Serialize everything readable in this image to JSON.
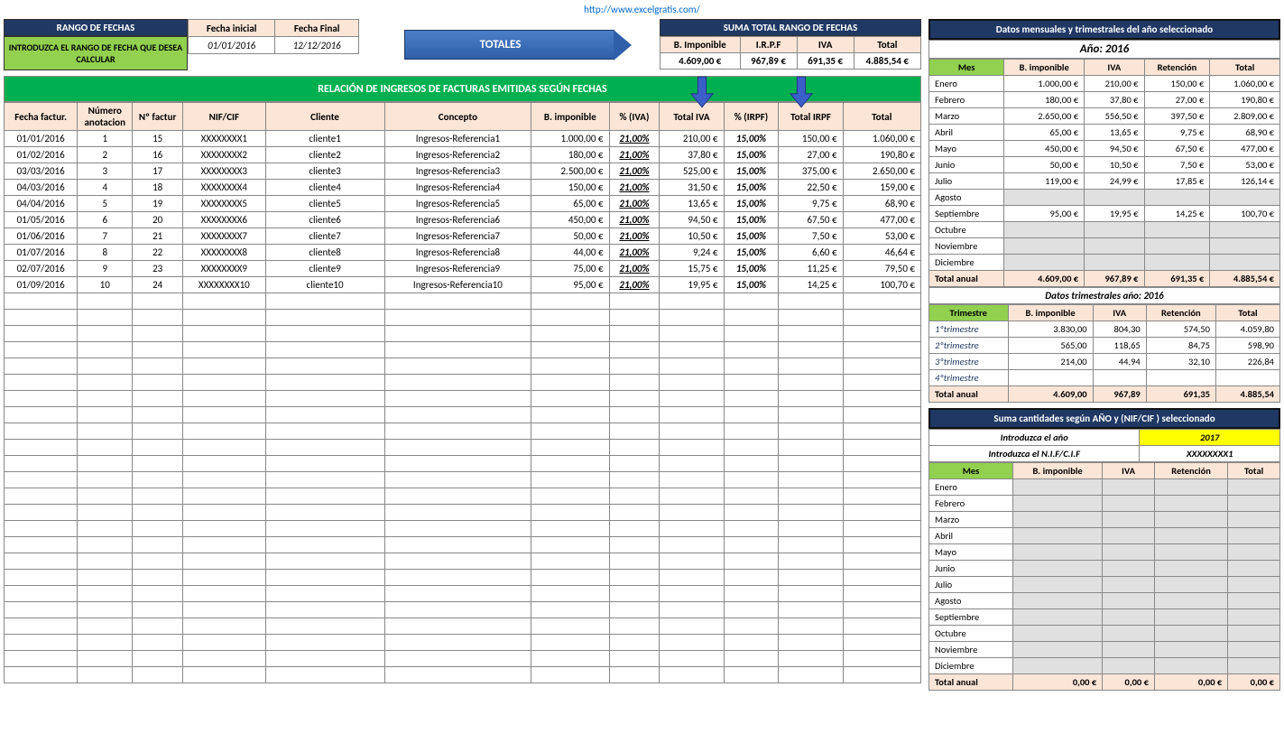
{
  "toplink": "http://www.excelgratis.com/",
  "headers": {
    "rango_fechas": "RANGO DE FECHAS",
    "intro_rango": "INTRODUZCA EL RANGO DE FECHA QUE DESEA CALCULAR",
    "fecha_inicial": "Fecha inicial",
    "fecha_final": "Fecha Final",
    "fecha_inicial_val": "01/01/2016",
    "fecha_final_val": "12/12/2016",
    "totales": "TOTALES",
    "suma_total": "SUMA TOTAL RANGO DE FECHAS",
    "bimponible": "B. Imponible",
    "irpf": "I.R.P.F",
    "iva": "IVA",
    "total": "Total",
    "bimponible_val": "4.609,00 €",
    "irpf_val": "967,89 €",
    "iva_val": "691,35 €",
    "total_val": "4.885,54 €",
    "green_banner": "RELACIÓN DE INGRESOS  DE FACTURAS EMITIDAS SEGÚN FECHAS"
  },
  "main_cols": [
    "Fecha factur.",
    "Número anotacion",
    "Nº factur",
    "NIF/CIF",
    "Cliente",
    "Concepto",
    "B. imponible",
    "% (IVA)",
    "Total IVA",
    "% (IRPF)",
    "Total IRPF",
    "Total"
  ],
  "main_rows": [
    [
      "01/01/2016",
      "1",
      "15",
      "XXXXXXXX1",
      "cliente1",
      "Ingresos-Referencia1",
      "1.000,00 €",
      "21,00%",
      "210,00 €",
      "15,00%",
      "150,00 €",
      "1.060,00 €"
    ],
    [
      "01/02/2016",
      "2",
      "16",
      "XXXXXXXX2",
      "cliente2",
      "Ingresos-Referencia2",
      "180,00 €",
      "21,00%",
      "37,80 €",
      "15,00%",
      "27,00 €",
      "190,80 €"
    ],
    [
      "03/03/2016",
      "3",
      "17",
      "XXXXXXXX3",
      "cliente3",
      "Ingresos-Referencia3",
      "2.500,00 €",
      "21,00%",
      "525,00 €",
      "15,00%",
      "375,00 €",
      "2.650,00 €"
    ],
    [
      "04/03/2016",
      "4",
      "18",
      "XXXXXXXX4",
      "cliente4",
      "Ingresos-Referencia4",
      "150,00 €",
      "21,00%",
      "31,50 €",
      "15,00%",
      "22,50 €",
      "159,00 €"
    ],
    [
      "04/04/2016",
      "5",
      "19",
      "XXXXXXXX5",
      "cliente5",
      "Ingresos-Referencia5",
      "65,00 €",
      "21,00%",
      "13,65 €",
      "15,00%",
      "9,75 €",
      "68,90 €"
    ],
    [
      "01/05/2016",
      "6",
      "20",
      "XXXXXXXX6",
      "cliente6",
      "Ingresos-Referencia6",
      "450,00 €",
      "21,00%",
      "94,50 €",
      "15,00%",
      "67,50 €",
      "477,00 €"
    ],
    [
      "01/06/2016",
      "7",
      "21",
      "XXXXXXXX7",
      "cliente7",
      "Ingresos-Referencia7",
      "50,00 €",
      "21,00%",
      "10,50 €",
      "15,00%",
      "7,50 €",
      "53,00 €"
    ],
    [
      "01/07/2016",
      "8",
      "22",
      "XXXXXXXX8",
      "cliente8",
      "Ingresos-Referencia8",
      "44,00 €",
      "21,00%",
      "9,24 €",
      "15,00%",
      "6,60 €",
      "46,64 €"
    ],
    [
      "02/07/2016",
      "9",
      "23",
      "XXXXXXXX9",
      "cliente9",
      "Ingresos-Referencia9",
      "75,00 €",
      "21,00%",
      "15,75 €",
      "15,00%",
      "11,25 €",
      "79,50 €"
    ],
    [
      "01/09/2016",
      "10",
      "24",
      "XXXXXXXX10",
      "cliente10",
      "Ingresos-Referencia10",
      "95,00 €",
      "21,00%",
      "19,95 €",
      "15,00%",
      "14,25 €",
      "100,70 €"
    ]
  ],
  "main_empty_rows": 24,
  "right1": {
    "title": "Datos mensuales  y trimestrales del año seleccionado",
    "ano": "Año:  2016",
    "cols": [
      "Mes",
      "B. imponible",
      "IVA",
      "Retención",
      "Total"
    ],
    "rows": [
      [
        "Enero",
        "1.000,00 €",
        "210,00 €",
        "150,00 €",
        "1.060,00 €"
      ],
      [
        "Febrero",
        "180,00 €",
        "37,80 €",
        "27,00 €",
        "190,80 €"
      ],
      [
        "Marzo",
        "2.650,00 €",
        "556,50 €",
        "397,50 €",
        "2.809,00 €"
      ],
      [
        "Abril",
        "65,00 €",
        "13,65 €",
        "9,75 €",
        "68,90 €"
      ],
      [
        "Mayo",
        "450,00 €",
        "94,50 €",
        "67,50 €",
        "477,00 €"
      ],
      [
        "Junio",
        "50,00 €",
        "10,50 €",
        "7,50 €",
        "53,00 €"
      ],
      [
        "Julio",
        "119,00 €",
        "24,99 €",
        "17,85 €",
        "126,14 €"
      ],
      [
        "Agosto",
        "",
        "",
        "",
        ""
      ],
      [
        "Septiembre",
        "95,00 €",
        "19,95 €",
        "14,25 €",
        "100,70 €"
      ],
      [
        "Octubre",
        "",
        "",
        "",
        ""
      ],
      [
        "Noviembre",
        "",
        "",
        "",
        ""
      ],
      [
        "Diciembre",
        "",
        "",
        "",
        ""
      ]
    ],
    "total": [
      "Total anual",
      "4.609,00 €",
      "967,89 €",
      "691,35 €",
      "4.885,54 €"
    ],
    "trim_title": "Datos trimestrales año: 2016",
    "trim_cols": [
      "Trimestre",
      "B. imponible",
      "IVA",
      "Retención",
      "Total"
    ],
    "trim_rows": [
      [
        "1ºtrimestre",
        "3.830,00",
        "804,30",
        "574,50",
        "4.059,80"
      ],
      [
        "2ºtrimestre",
        "565,00",
        "118,65",
        "84,75",
        "598,90"
      ],
      [
        "3ºtrimestre",
        "214,00",
        "44,94",
        "32,10",
        "226,84"
      ],
      [
        "4ºtrimestre",
        "",
        "",
        "",
        ""
      ]
    ],
    "trim_total": [
      "Total anual",
      "4.609,00",
      "967,89",
      "691,35",
      "4.885,54"
    ]
  },
  "right2": {
    "title": "Suma cantidades según  AÑO y  (NIF/CIF )  seleccionado",
    "intro_ano": "Introduzca  el año",
    "ano_val": "2017",
    "intro_nif": "Introduzca el  N.I.F/C.I.F",
    "nif_val": "XXXXXXXX1",
    "cols": [
      "Mes",
      "B. imponible",
      "IVA",
      "Retención",
      "Total"
    ],
    "rows": [
      [
        "Enero",
        "",
        "",
        "",
        ""
      ],
      [
        "Febrero",
        "",
        "",
        "",
        ""
      ],
      [
        "Marzo",
        "",
        "",
        "",
        ""
      ],
      [
        "Abril",
        "",
        "",
        "",
        ""
      ],
      [
        "Mayo",
        "",
        "",
        "",
        ""
      ],
      [
        "Junio",
        "",
        "",
        "",
        ""
      ],
      [
        "Julio",
        "",
        "",
        "",
        ""
      ],
      [
        "Agosto",
        "",
        "",
        "",
        ""
      ],
      [
        "Septiembre",
        "",
        "",
        "",
        ""
      ],
      [
        "Octubre",
        "",
        "",
        "",
        ""
      ],
      [
        "Noviembre",
        "",
        "",
        "",
        ""
      ],
      [
        "Diciembre",
        "",
        "",
        "",
        ""
      ]
    ],
    "total": [
      "Total anual",
      "0,00 €",
      "0,00 €",
      "0,00 €",
      "0,00 €"
    ]
  }
}
